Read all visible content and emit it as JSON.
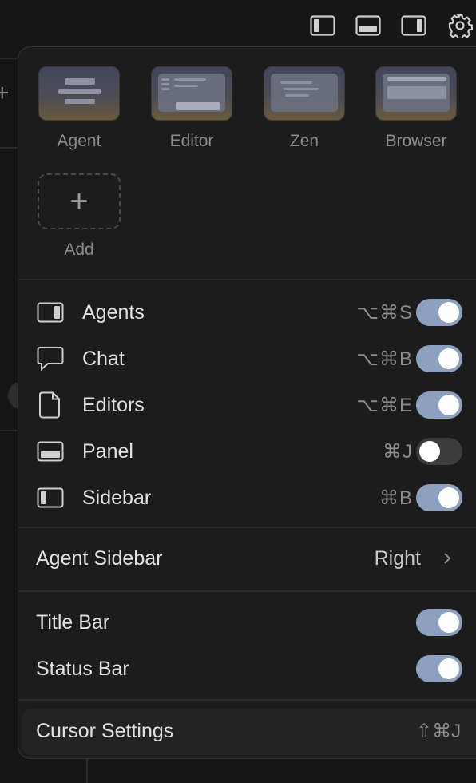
{
  "layouts": [
    {
      "label": "Agent"
    },
    {
      "label": "Editor"
    },
    {
      "label": "Zen"
    },
    {
      "label": "Browser"
    }
  ],
  "add_label": "Add",
  "add_glyph": "+",
  "view_toggles": [
    {
      "label": "Agents",
      "shortcut": "⌥⌘S",
      "enabled": true,
      "icon": "agents-panel-icon"
    },
    {
      "label": "Chat",
      "shortcut": "⌥⌘B",
      "enabled": true,
      "icon": "chat-bubble-icon"
    },
    {
      "label": "Editors",
      "shortcut": "⌥⌘E",
      "enabled": true,
      "icon": "file-icon"
    },
    {
      "label": "Panel",
      "shortcut": "⌘J",
      "enabled": false,
      "icon": "bottom-panel-icon"
    },
    {
      "label": "Sidebar",
      "shortcut": "⌘B",
      "enabled": true,
      "icon": "left-sidebar-icon"
    }
  ],
  "agent_sidebar": {
    "label": "Agent Sidebar",
    "value": "Right"
  },
  "bars": [
    {
      "label": "Title Bar",
      "enabled": true
    },
    {
      "label": "Status Bar",
      "enabled": true
    }
  ],
  "cursor_settings": {
    "label": "Cursor Settings",
    "shortcut": "⇧⌘J"
  },
  "colors": {
    "toggle_on": "#8ea0bf",
    "toggle_off": "#3c3c3c",
    "menu_bg": "#1c1c1c"
  }
}
